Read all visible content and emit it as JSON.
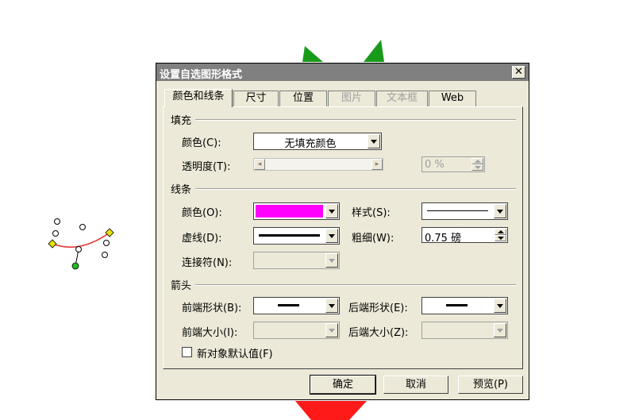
{
  "dialog": {
    "title": "设置自选图形格式",
    "close_glyph": "✕"
  },
  "tabs": [
    {
      "label": "颜色和线条",
      "active": true,
      "disabled": false
    },
    {
      "label": "尺寸",
      "active": false,
      "disabled": false
    },
    {
      "label": "位置",
      "active": false,
      "disabled": false
    },
    {
      "label": "图片",
      "active": false,
      "disabled": true
    },
    {
      "label": "文本框",
      "active": false,
      "disabled": true
    },
    {
      "label": "Web",
      "active": false,
      "disabled": false
    }
  ],
  "fill": {
    "section": "填充",
    "color_label": "颜色(C):",
    "color_value": "无填充颜色",
    "transparency_label": "透明度(T):",
    "transparency_value": "0 %",
    "scroll_left": "◂",
    "scroll_right": "▸"
  },
  "line": {
    "section": "线条",
    "color_label": "颜色(O):",
    "color_value": "#ff00ff",
    "style_label": "样式(S):",
    "dash_label": "虚线(D):",
    "weight_label": "粗细(W):",
    "weight_value": "0.75 磅",
    "connector_label": "连接符(N):"
  },
  "arrows": {
    "section": "箭头",
    "begin_style_label": "前端形状(B):",
    "end_style_label": "后端形状(E):",
    "begin_size_label": "前端大小(I):",
    "end_size_label": "后端大小(Z):"
  },
  "default_checkbox_label": "新对象默认值(F)",
  "buttons": {
    "ok": "确定",
    "cancel": "取消",
    "preview": "预览(P)"
  },
  "colors": {
    "title_bar": "#808080",
    "dialog_bg": "#ece9d8",
    "shape_green": "#1a9a1a",
    "shape_red": "#ff1a1a",
    "arc_red": "#e03030",
    "handle_yellow": "#e8e000"
  }
}
